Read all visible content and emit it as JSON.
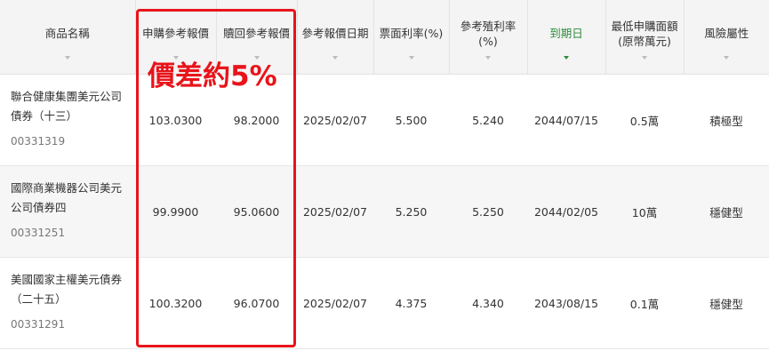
{
  "columns": [
    {
      "label": "商品名稱",
      "active": false
    },
    {
      "label": "申購參考報價",
      "active": false
    },
    {
      "label": "贖回參考報價",
      "active": false
    },
    {
      "label": "參考報價日期",
      "active": false
    },
    {
      "label": "票面利率(%)",
      "active": false
    },
    {
      "label": "參考殖利率(%)",
      "active": false
    },
    {
      "label": "到期日",
      "active": true
    },
    {
      "label": "最低申購面額\n(原幣萬元)",
      "active": false
    },
    {
      "label": "風險屬性",
      "active": false
    }
  ],
  "rows": [
    {
      "name": "聯合健康集團美元公司債券（十三）",
      "code": "00331319",
      "buy_price": "103.0300",
      "redeem_price": "98.2000",
      "quote_date": "2025/02/07",
      "coupon_rate": "5.500",
      "yield": "5.240",
      "maturity": "2044/07/15",
      "min_amount": "0.5萬",
      "risk": "積極型"
    },
    {
      "name": "國際商業機器公司美元公司債券四",
      "code": "00331251",
      "buy_price": "99.9900",
      "redeem_price": "95.0600",
      "quote_date": "2025/02/07",
      "coupon_rate": "5.250",
      "yield": "5.250",
      "maturity": "2044/02/05",
      "min_amount": "10萬",
      "risk": "穩健型"
    },
    {
      "name": "美國國家主權美元債券（二十五）",
      "code": "00331291",
      "buy_price": "100.3200",
      "redeem_price": "96.0700",
      "quote_date": "2025/02/07",
      "coupon_rate": "4.375",
      "yield": "4.340",
      "maturity": "2043/08/15",
      "min_amount": "0.1萬",
      "risk": "穩健型"
    }
  ],
  "annotation": "價差約5%",
  "colors": {
    "header_bg": "#f4f4f4",
    "active_sort": "#2e8b3c",
    "highlight": "#e8141a",
    "row_alt": "#f6f6f6"
  }
}
